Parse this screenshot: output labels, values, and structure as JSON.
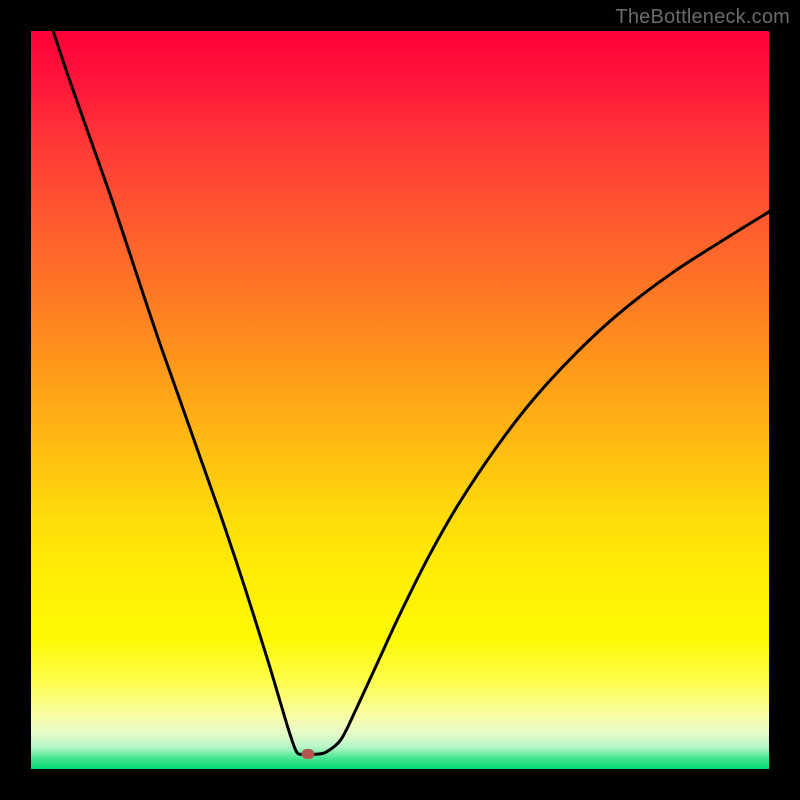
{
  "watermark": "TheBottleneck.com",
  "chart_data": {
    "type": "line",
    "title": "",
    "xlabel": "",
    "ylabel": "",
    "xlim": [
      0,
      100
    ],
    "ylim": [
      0,
      100
    ],
    "x": [
      3,
      5,
      8,
      11,
      14,
      17,
      20,
      23,
      26,
      29,
      32,
      33.5,
      35,
      36,
      37,
      38.5,
      40,
      42,
      44,
      47,
      50,
      54,
      58,
      63,
      68,
      74,
      80,
      87,
      94,
      100
    ],
    "y": [
      100,
      94,
      85.5,
      77,
      68,
      59,
      50.5,
      42,
      33.5,
      24.5,
      15,
      10,
      5,
      2.3,
      2,
      2,
      2.3,
      4,
      8,
      14.5,
      21,
      29,
      36,
      43.5,
      50,
      56.5,
      62,
      67.3,
      71.8,
      75.5
    ],
    "marker": {
      "x": 37.5,
      "y": 2
    },
    "gradient_colors": {
      "top": "#ff0038",
      "bottom": "#00da71"
    }
  }
}
